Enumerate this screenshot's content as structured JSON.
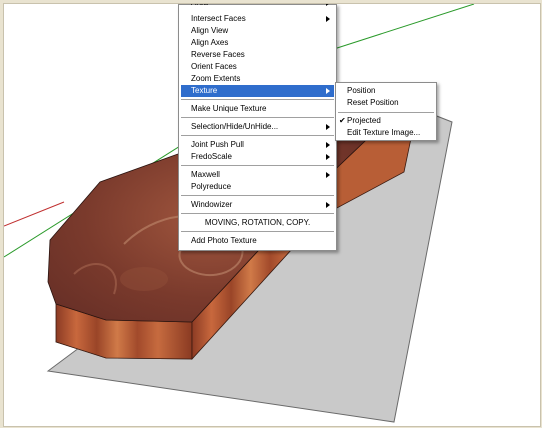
{
  "context_menu": {
    "items": [
      {
        "label": "Area",
        "arrow": true
      },
      {
        "label": "Intersect Faces",
        "arrow": true
      },
      {
        "label": "Align View",
        "arrow": false
      },
      {
        "label": "Align Axes",
        "arrow": false
      },
      {
        "label": "Reverse Faces",
        "arrow": false
      },
      {
        "label": "Orient Faces",
        "arrow": false
      },
      {
        "label": "Zoom Extents",
        "arrow": false
      },
      {
        "label": "Texture",
        "arrow": true,
        "selected": true
      },
      {
        "label": "Make Unique Texture",
        "arrow": false
      },
      {
        "label": "Selection/Hide/UnHide...",
        "arrow": true
      },
      {
        "label": "Joint Push Pull",
        "arrow": true
      },
      {
        "label": "FredoScale",
        "arrow": true
      },
      {
        "label": "Maxwell",
        "arrow": true
      },
      {
        "label": "Polyreduce",
        "arrow": false
      },
      {
        "label": "Windowizer",
        "arrow": true
      },
      {
        "label": "MOVING, ROTATION, COPY.",
        "arrow": false
      },
      {
        "label": "Add Photo Texture",
        "arrow": false
      }
    ]
  },
  "texture_submenu": {
    "items": [
      {
        "label": "Position",
        "checked": false
      },
      {
        "label": "Reset Position",
        "checked": false
      },
      {
        "label": "Projected",
        "checked": true
      },
      {
        "label": "Edit Texture Image...",
        "checked": false
      }
    ]
  },
  "colors": {
    "menu_highlight": "#2f6dcc",
    "axis_green": "#2a9a2a",
    "axis_red": "#c03030",
    "ground": "#c9c9c9",
    "wood_side": "#b0552e",
    "wood_top": "#7a3b2c"
  }
}
